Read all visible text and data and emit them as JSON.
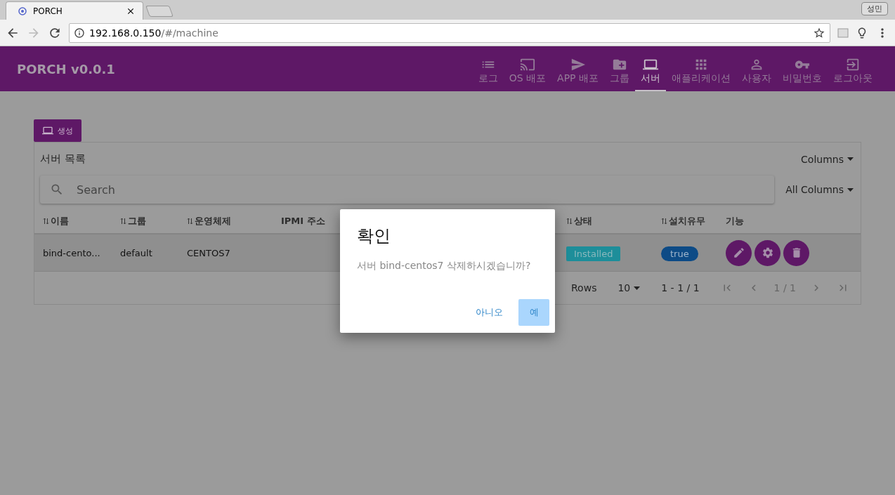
{
  "browser": {
    "tab_title": "PORCH",
    "profile": "성민",
    "address_host": "192.168.0.150",
    "address_path": "/#/machine"
  },
  "app": {
    "title": "PORCH v0.0.1",
    "nav": [
      {
        "label": "로그",
        "kind": "list",
        "selected": false
      },
      {
        "label": "OS 배포",
        "kind": "cast",
        "selected": false
      },
      {
        "label": "APP 배포",
        "kind": "send",
        "selected": false
      },
      {
        "label": "그룹",
        "kind": "folder",
        "selected": false
      },
      {
        "label": "서버",
        "kind": "laptop",
        "selected": true
      },
      {
        "label": "애플리케이션",
        "kind": "apps",
        "selected": false
      },
      {
        "label": "사용자",
        "kind": "person",
        "selected": false
      },
      {
        "label": "비밀번호",
        "kind": "key",
        "selected": false
      },
      {
        "label": "로그아웃",
        "kind": "logout",
        "selected": false
      }
    ]
  },
  "create_button": "생성",
  "table": {
    "title": "서버 목록",
    "columns_menu": "Columns",
    "search_placeholder": "Search",
    "filter": "All Columns",
    "columns": [
      {
        "label": "이름",
        "sortable": true
      },
      {
        "label": "그룹",
        "sortable": true
      },
      {
        "label": "운영체제",
        "sortable": true
      },
      {
        "label": "IPMI 주소",
        "sortable": false
      },
      {
        "label": "상태",
        "sortable": true
      },
      {
        "label": "설치유무",
        "sortable": true
      },
      {
        "label": "기능",
        "sortable": false
      }
    ],
    "rows": [
      {
        "name": "bind-cento...",
        "group": "default",
        "os": "CENTOS7",
        "ipmi": "",
        "status": "Installed",
        "installed": "true"
      }
    ],
    "footer": {
      "rows_label": "Rows",
      "rows_per_page": "10",
      "range": "1 - 1 / 1",
      "page": "1 / 1"
    }
  },
  "dialog": {
    "title": "확인",
    "message": "서버 bind-centos7 삭제하시겠습니까?",
    "buttons": [
      {
        "label": "아니오",
        "kind": "flat"
      },
      {
        "label": "예",
        "kind": "primary"
      }
    ]
  }
}
